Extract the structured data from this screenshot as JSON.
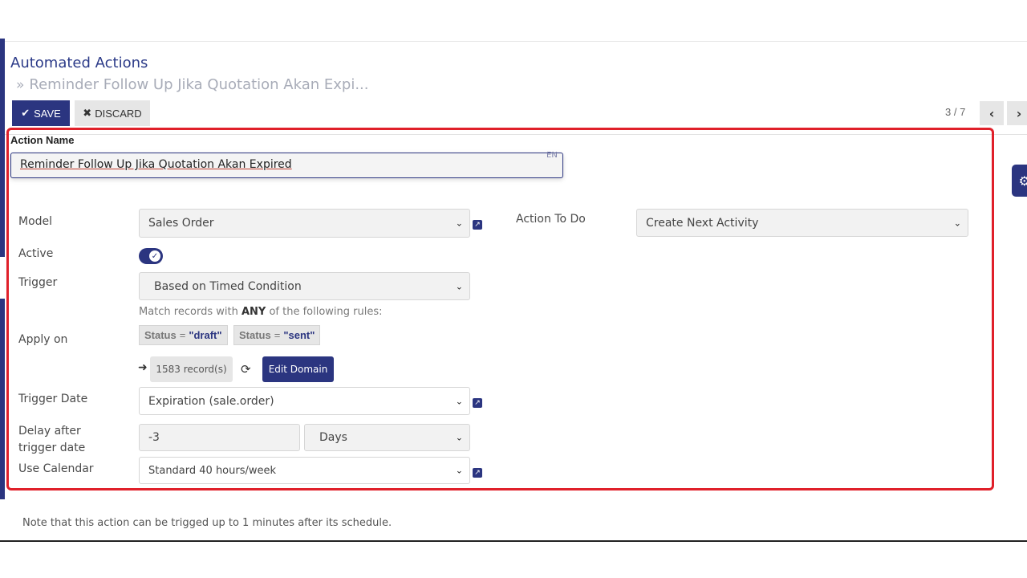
{
  "breadcrumb": {
    "parent": "Automated Actions",
    "current": "Reminder Follow Up Jika Quotation Akan Expi..."
  },
  "toolbar": {
    "save_label": "SAVE",
    "discard_label": "DISCARD"
  },
  "pager": {
    "value": "3 / 7"
  },
  "form": {
    "action_name_label": "Action Name",
    "action_name_value": "Reminder Follow Up Jika Quotation Akan Expired",
    "lang_tag": "EN",
    "model_label": "Model",
    "model_value": "Sales Order",
    "action_to_do_label": "Action To Do",
    "action_to_do_value": "Create Next Activity",
    "active_label": "Active",
    "active_value": true,
    "trigger_label": "Trigger",
    "trigger_value": "Based on Timed Condition",
    "apply_on_label": "Apply on",
    "domain_hint_prefix": "Match records with",
    "domain_hint_bold": "ANY",
    "domain_hint_suffix": "of the following rules:",
    "rules": [
      {
        "field": "Status",
        "op": "=",
        "value": "\"draft\""
      },
      {
        "field": "Status",
        "op": "=",
        "value": "\"sent\""
      }
    ],
    "records_count": "1583 record(s)",
    "edit_domain_label": "Edit Domain",
    "trigger_date_label": "Trigger Date",
    "trigger_date_value": "Expiration (sale.order)",
    "delay_label_1": "Delay after",
    "delay_label_2": "trigger date",
    "delay_value": "-3",
    "delay_unit": "Days",
    "calendar_label": "Use Calendar",
    "calendar_value": "Standard 40 hours/week"
  },
  "footer": {
    "note": "Note that this action can be trigged up to 1 minutes after its schedule."
  },
  "colors": {
    "primary": "#2b3580",
    "highlight_border": "#e0202a"
  }
}
